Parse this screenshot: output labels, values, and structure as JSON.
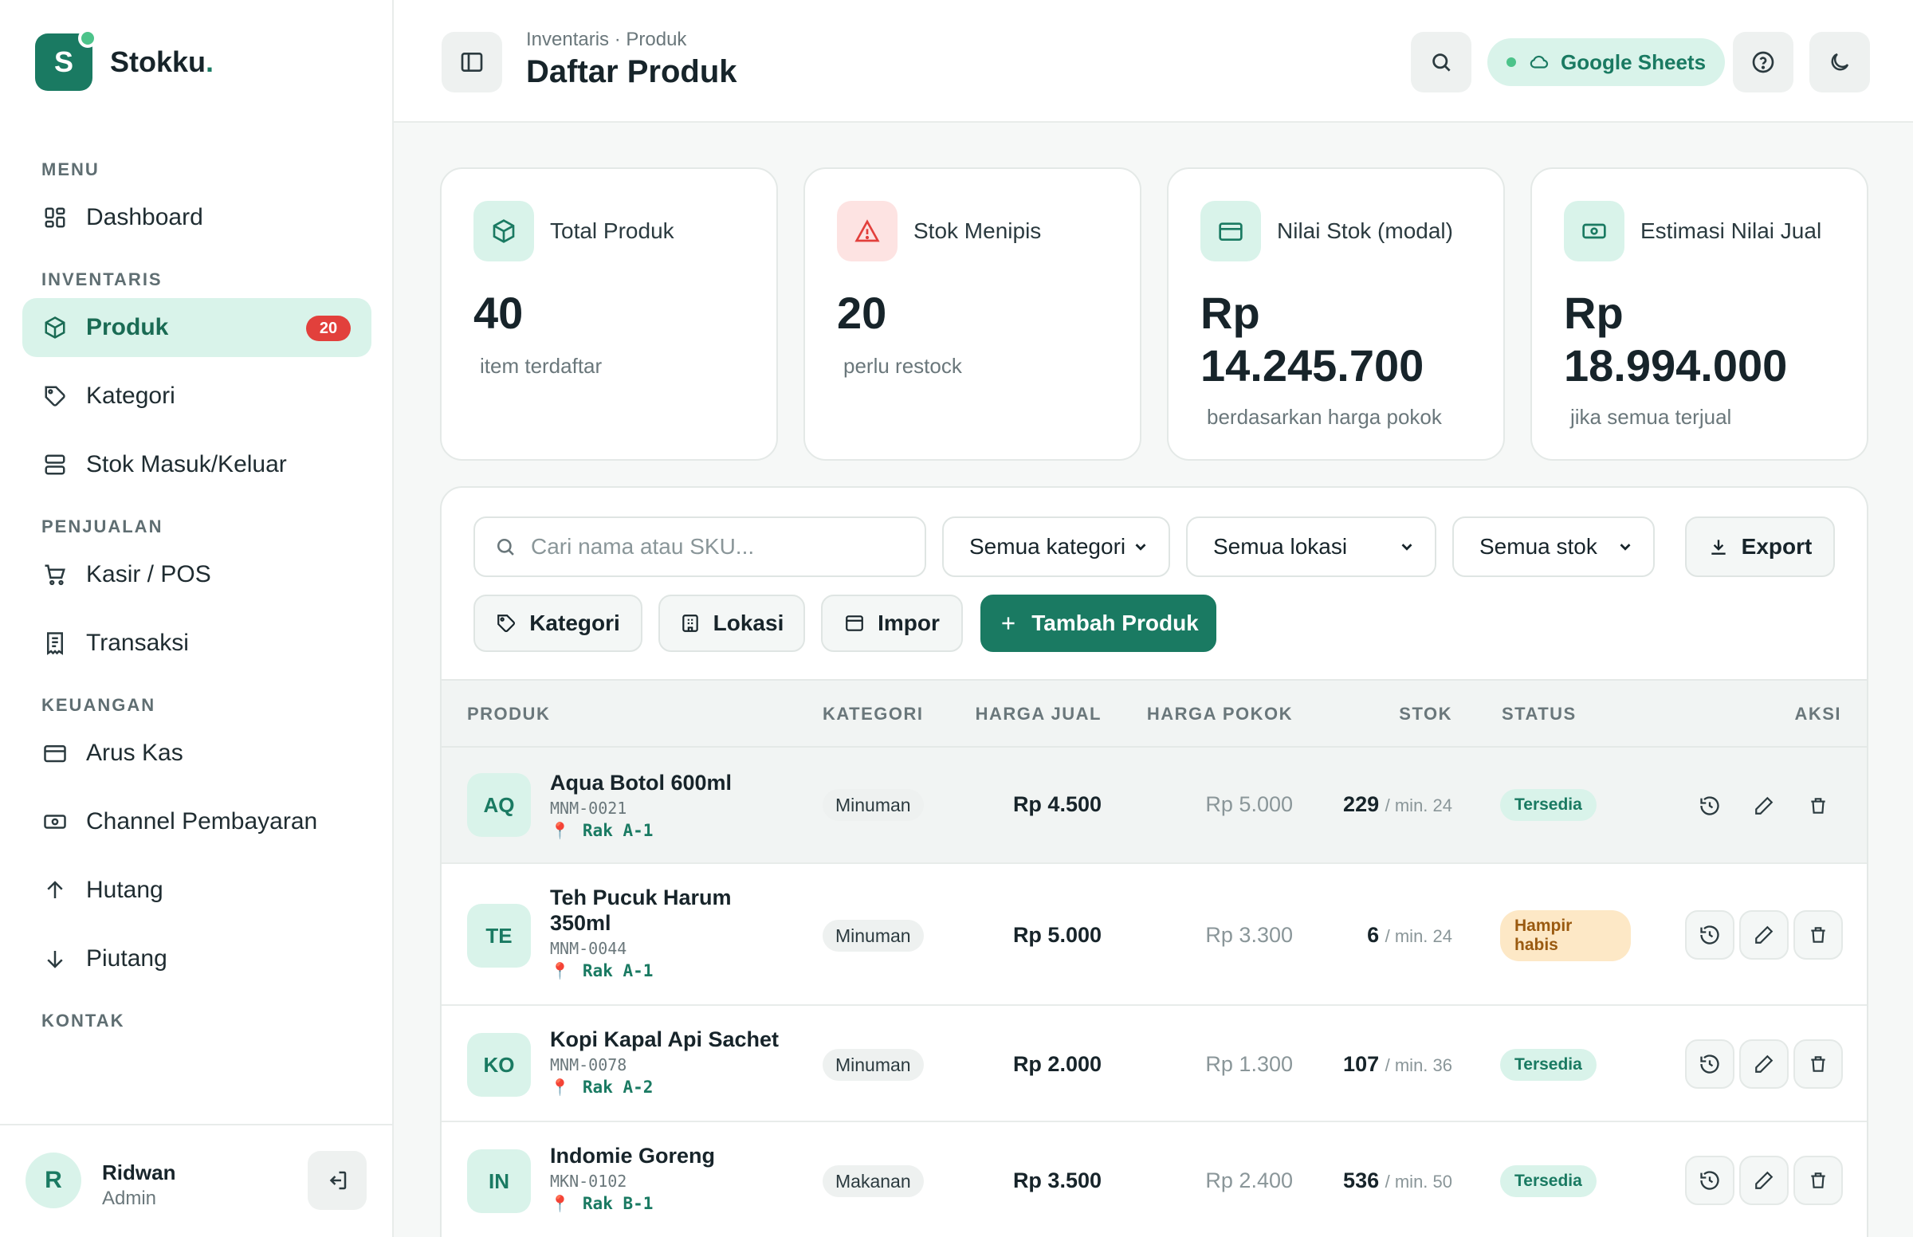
{
  "app": {
    "brand": "Stokku",
    "brand_dot": ".",
    "logo_letter": "S"
  },
  "sidebar": {
    "sections": [
      {
        "title": "MENU"
      },
      {
        "title": "INVENTARIS"
      },
      {
        "title": "PENJUALAN"
      },
      {
        "title": "KEUANGAN"
      },
      {
        "title": "KONTAK"
      }
    ],
    "items": [
      {
        "label": "Dashboard",
        "icon": "grid-icon"
      },
      {
        "label": "Produk",
        "icon": "box-icon",
        "badge": "20",
        "active": true
      },
      {
        "label": "Kategori",
        "icon": "tag-icon"
      },
      {
        "label": "Stok Masuk/Keluar",
        "icon": "server-icon"
      },
      {
        "label": "Kasir / POS",
        "icon": "cart-icon"
      },
      {
        "label": "Transaksi",
        "icon": "receipt-icon"
      },
      {
        "label": "Arus Kas",
        "icon": "wallet-icon"
      },
      {
        "label": "Channel Pembayaran",
        "icon": "banknote-icon"
      },
      {
        "label": "Hutang",
        "icon": "arrow-up-icon"
      },
      {
        "label": "Piutang",
        "icon": "arrow-down-icon"
      }
    ],
    "user": {
      "initial": "R",
      "name": "Ridwan",
      "role": "Admin"
    }
  },
  "header": {
    "breadcrumb": "Inventaris · Produk",
    "title": "Daftar Produk",
    "sheets_label": "Google Sheets"
  },
  "stats": [
    {
      "label": "Total Produk",
      "value": "40",
      "sub": "item terdaftar",
      "icon": "box-icon"
    },
    {
      "label": "Stok Menipis",
      "value": "20",
      "sub": "perlu restock",
      "icon": "alert-triangle-icon"
    },
    {
      "label": "Nilai Stok (modal)",
      "value_line1": "Rp",
      "value_line2": "14.245.700",
      "sub": "berdasarkan harga pokok",
      "icon": "wallet-icon"
    },
    {
      "label": "Estimasi Nilai Jual",
      "value_line1": "Rp",
      "value_line2": "18.994.000",
      "sub": "jika semua terjual",
      "icon": "banknote-icon"
    }
  ],
  "filters": {
    "search_placeholder": "Cari nama atau SKU...",
    "category": "Semua kategori",
    "location": "Semua lokasi",
    "stock": "Semua stok",
    "export": "Export",
    "btn_category": "Kategori",
    "btn_location": "Lokasi",
    "btn_import": "Impor",
    "btn_add": "Tambah Produk"
  },
  "table": {
    "columns": [
      "PRODUK",
      "KATEGORI",
      "HARGA JUAL",
      "HARGA POKOK",
      "STOK",
      "STATUS",
      "AKSI"
    ],
    "rows": [
      {
        "code": "AQ",
        "name": "Aqua Botol 600ml",
        "sku": "MNM-0021",
        "loc": "Rak A-1",
        "category": "Minuman",
        "price": "Rp 4.500",
        "cost": "Rp 5.000",
        "stock": "229",
        "min": "/ min. 24",
        "status": "Tersedia",
        "status_type": "ok"
      },
      {
        "code": "TE",
        "name": "Teh Pucuk Harum 350ml",
        "sku": "MNM-0044",
        "loc": "Rak A-1",
        "category": "Minuman",
        "price": "Rp 5.000",
        "cost": "Rp 3.300",
        "stock": "6",
        "min": "/ min. 24",
        "status_line1": "Hampir",
        "status_line2": "habis",
        "status_type": "warn"
      },
      {
        "code": "KO",
        "name": "Kopi Kapal Api Sachet",
        "sku": "MNM-0078",
        "loc": "Rak A-2",
        "category": "Minuman",
        "price": "Rp 2.000",
        "cost": "Rp 1.300",
        "stock": "107",
        "min": "/ min. 36",
        "status": "Tersedia",
        "status_type": "ok"
      },
      {
        "code": "IN",
        "name": "Indomie Goreng",
        "sku": "MKN-0102",
        "loc": "Rak B-1",
        "category": "Makanan",
        "price": "Rp 3.500",
        "cost": "Rp 2.400",
        "stock": "536",
        "min": "/ min. 50",
        "status": "Tersedia",
        "status_type": "ok"
      }
    ]
  }
}
